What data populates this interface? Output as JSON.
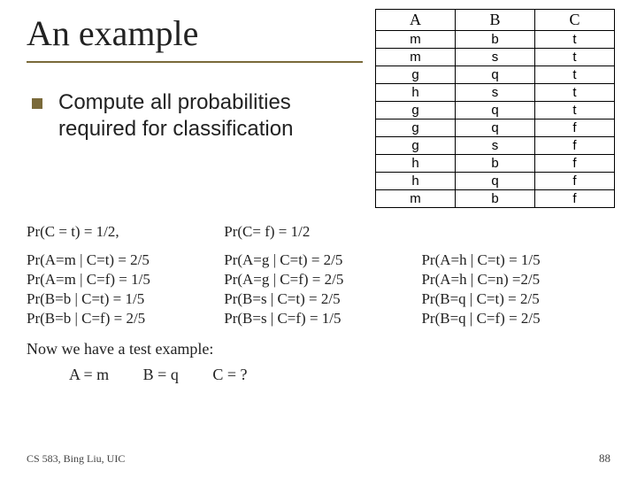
{
  "title": "An example",
  "bullet_text": "Compute all probabilities required for classification",
  "table": {
    "headers": [
      "A",
      "B",
      "C"
    ],
    "rows": [
      [
        "m",
        "b",
        "t"
      ],
      [
        "m",
        "s",
        "t"
      ],
      [
        "g",
        "q",
        "t"
      ],
      [
        "h",
        "s",
        "t"
      ],
      [
        "g",
        "q",
        "t"
      ],
      [
        "g",
        "q",
        "f"
      ],
      [
        "g",
        "s",
        "f"
      ],
      [
        "h",
        "b",
        "f"
      ],
      [
        "h",
        "q",
        "f"
      ],
      [
        "m",
        "b",
        "f"
      ]
    ]
  },
  "priors": {
    "pt": "Pr(C = t) = 1/2,",
    "pf": "Pr(C= f) = 1/2"
  },
  "conds": {
    "r1c1": "Pr(A=m | C=t) = 2/5",
    "r1c2": "Pr(A=g | C=t) = 2/5",
    "r1c3": "Pr(A=h | C=t) = 1/5",
    "r2c1": "Pr(A=m | C=f) = 1/5",
    "r2c2": "Pr(A=g | C=f) = 2/5",
    "r2c3": "Pr(A=h | C=n) =2/5",
    "r3c1": "Pr(B=b | C=t) = 1/5",
    "r3c2": "Pr(B=s | C=t) = 2/5",
    "r3c3": "Pr(B=q | C=t) = 2/5",
    "r4c1": "Pr(B=b | C=f) = 2/5",
    "r4c2": "Pr(B=s | C=f) = 1/5",
    "r4c3": "Pr(B=q | C=f) = 2/5"
  },
  "test_label": "Now we have a test example:",
  "test_example": {
    "a": "A = m",
    "b": "B = q",
    "c": "C = ?"
  },
  "footer": "CS 583, Bing Liu, UIC",
  "page_num": "88",
  "chart_data": {
    "type": "table",
    "title": "Training data for Naive Bayes example",
    "columns": [
      "A",
      "B",
      "C"
    ],
    "rows": [
      [
        "m",
        "b",
        "t"
      ],
      [
        "m",
        "s",
        "t"
      ],
      [
        "g",
        "q",
        "t"
      ],
      [
        "h",
        "s",
        "t"
      ],
      [
        "g",
        "q",
        "t"
      ],
      [
        "g",
        "q",
        "f"
      ],
      [
        "g",
        "s",
        "f"
      ],
      [
        "h",
        "b",
        "f"
      ],
      [
        "h",
        "q",
        "f"
      ],
      [
        "m",
        "b",
        "f"
      ]
    ],
    "priors": {
      "Pr(C=t)": 0.5,
      "Pr(C=f)": 0.5
    },
    "conditionals": {
      "Pr(A=m|C=t)": 0.4,
      "Pr(A=g|C=t)": 0.4,
      "Pr(A=h|C=t)": 0.2,
      "Pr(A=m|C=f)": 0.2,
      "Pr(A=g|C=f)": 0.4,
      "Pr(A=h|C=f)": 0.4,
      "Pr(B=b|C=t)": 0.2,
      "Pr(B=s|C=t)": 0.4,
      "Pr(B=q|C=t)": 0.4,
      "Pr(B=b|C=f)": 0.4,
      "Pr(B=s|C=f)": 0.2,
      "Pr(B=q|C=f)": 0.4
    },
    "test_example": {
      "A": "m",
      "B": "q",
      "C": "?"
    }
  }
}
